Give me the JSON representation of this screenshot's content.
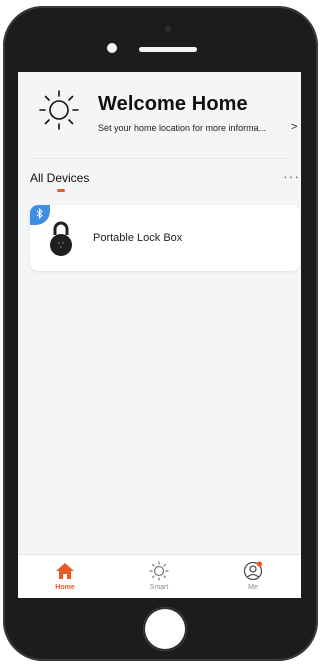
{
  "header": {
    "title": "Welcome Home",
    "subtitle": "Set your home location for more informa...",
    "chevron": ">"
  },
  "devices_section": {
    "label": "All Devices",
    "more": "···"
  },
  "devices": [
    {
      "name": "Portable Lock Box",
      "connection_icon": "bluetooth-icon",
      "icon": "lock-icon"
    }
  ],
  "tabbar": {
    "tabs": [
      {
        "label": "Home",
        "icon": "home-icon",
        "active": true
      },
      {
        "label": "Smart",
        "icon": "sun-icon",
        "active": false
      },
      {
        "label": "Me",
        "icon": "profile-icon",
        "active": false,
        "badge": true
      }
    ]
  },
  "colors": {
    "accent": "#e85a2a",
    "bluetooth": "#3d8fe6",
    "screen_bg": "#f3f5f7"
  }
}
